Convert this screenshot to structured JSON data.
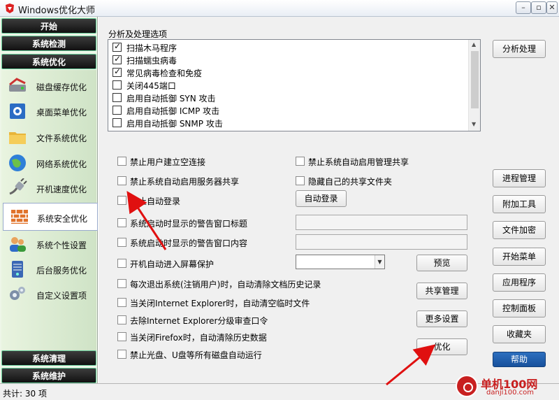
{
  "window": {
    "title": "Windows优化大师",
    "min": "–",
    "max": "▫",
    "close": "✕"
  },
  "nav": {
    "start": "开始",
    "detect": "系统检测",
    "optimize": "系统优化",
    "items": [
      {
        "label": "磁盘缓存优化",
        "icon": "disk-cache-icon"
      },
      {
        "label": "桌面菜单优化",
        "icon": "desktop-menu-icon"
      },
      {
        "label": "文件系统优化",
        "icon": "folder-icon"
      },
      {
        "label": "网络系统优化",
        "icon": "globe-icon"
      },
      {
        "label": "开机速度优化",
        "icon": "plug-icon"
      },
      {
        "label": "系统安全优化",
        "icon": "firewall-icon"
      },
      {
        "label": "系统个性设置",
        "icon": "users-icon"
      },
      {
        "label": "后台服务优化",
        "icon": "server-icon"
      },
      {
        "label": "自定义设置项",
        "icon": "gears-icon"
      }
    ],
    "clean": "系统清理",
    "maintain": "系统维护"
  },
  "analysis": {
    "group_label": "分析及处理选项",
    "items": [
      {
        "label": "扫描木马程序",
        "checked": true
      },
      {
        "label": "扫描蠕虫病毒",
        "checked": true
      },
      {
        "label": "常见病毒检查和免疫",
        "checked": true
      },
      {
        "label": "关闭445端口",
        "checked": false
      },
      {
        "label": "启用自动抵御 SYN 攻击",
        "checked": false
      },
      {
        "label": "启用自动抵御 ICMP 攻击",
        "checked": false
      },
      {
        "label": "启用自动抵御 SNMP 攻击",
        "checked": false
      }
    ]
  },
  "options": {
    "no_null_session": "禁止用户建立空连接",
    "no_admin_share": "禁止系统自动启用管理共享",
    "no_server_share": "禁止系统自动启用服务器共享",
    "hide_shared": "隐藏自己的共享文件夹",
    "no_autologon": "禁止自动登录",
    "warn_title": "系统启动时显示的警告窗口标题",
    "warn_content": "系统启动时显示的警告窗口内容",
    "screensaver": "开机自动进入屏幕保护",
    "clear_history": "每次退出系统(注销用户)时，自动清除文档历史记录",
    "ie_temp": "当关闭Internet Explorer时，自动清空临时文件",
    "ie_audit": "去除Internet Explorer分级审查口令",
    "firefox_history": "当关闭Firefox时，自动清除历史数据",
    "no_autorun": "禁止光盘、U盘等所有磁盘自动运行"
  },
  "buttons": {
    "analyze": "分析处理",
    "autologon": "自动登录",
    "preview": "预览",
    "share_mgr": "共享管理",
    "more": "更多设置",
    "optimize": "优化",
    "process": "进程管理",
    "tools": "附加工具",
    "encrypt": "文件加密",
    "start_menu": "开始菜单",
    "apps": "应用程序",
    "control": "控制面板",
    "favorites": "收藏夹",
    "help": "帮助"
  },
  "status": {
    "text": "共计: 30 项"
  },
  "watermark": {
    "brand": "单机100网",
    "url": "danji100.com"
  },
  "colors": {
    "accent": "#1a5aa8",
    "arrow": "#e01010",
    "nav_header": "#1a1a1a"
  }
}
